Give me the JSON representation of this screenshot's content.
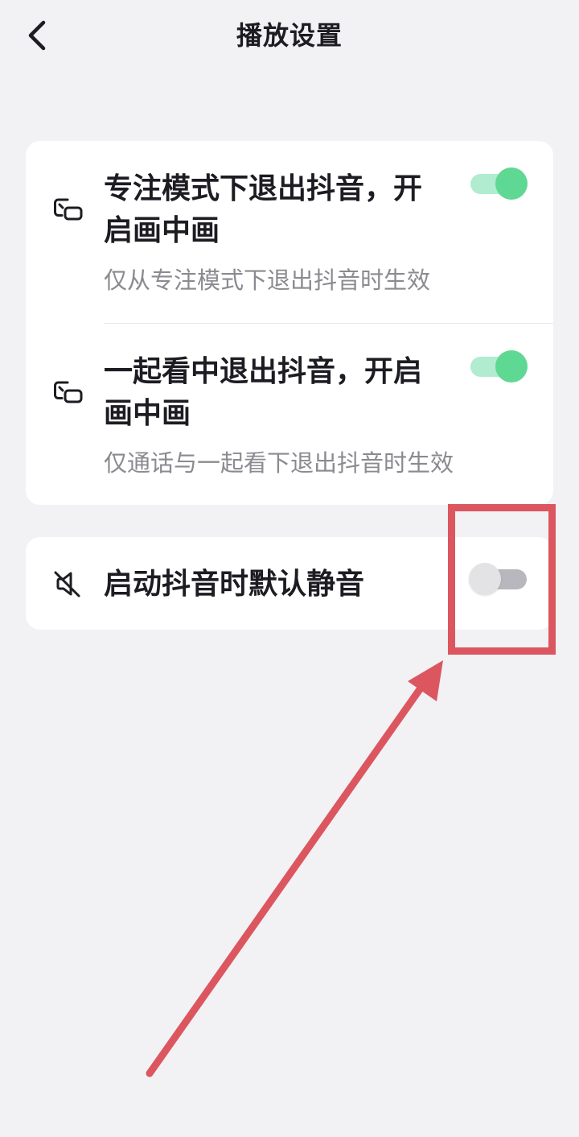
{
  "header": {
    "title": "播放设置",
    "back_icon": "chevron-left-icon"
  },
  "settings": {
    "pip_focus": {
      "icon": "picture-in-picture-icon",
      "title_line1": "专注模式下退出抖音，开",
      "title_line2": "启画中画",
      "description": "仅从专注模式下退出抖音时生效",
      "enabled": true
    },
    "pip_watch_together": {
      "icon": "picture-in-picture-icon",
      "title_line1": "一起看中退出抖音，开启",
      "title_line2": "画中画",
      "description": "仅通话与一起看下退出抖音时生效",
      "enabled": true
    },
    "mute_on_start": {
      "icon": "speaker-muted-icon",
      "title": "启动抖音时默认静音",
      "enabled": false
    }
  },
  "annotation": {
    "color": "#dc5660"
  },
  "colors": {
    "background": "#f2f1f3",
    "card": "#ffffff",
    "toggle_on_knob": "#5fd893",
    "toggle_on_track": "#b1ecd0",
    "toggle_off_track": "#b8b7bd"
  }
}
